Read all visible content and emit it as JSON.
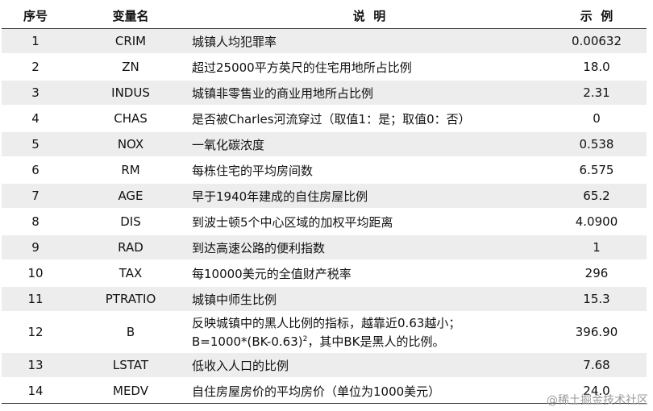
{
  "table": {
    "headers": {
      "index": "序号",
      "variable": "变量名",
      "description": "说  明",
      "example": "示  例"
    },
    "rows": [
      {
        "index": "1",
        "variable": "CRIM",
        "description": "城镇人均犯罪率",
        "example": "0.00632"
      },
      {
        "index": "2",
        "variable": "ZN",
        "description": "超过25000平方英尺的住宅用地所占比例",
        "example": "18.0"
      },
      {
        "index": "3",
        "variable": "INDUS",
        "description": "城镇非零售业的商业用地所占比例",
        "example": "2.31"
      },
      {
        "index": "4",
        "variable": "CHAS",
        "description": "是否被Charles河流穿过（取值1：是；取值0：否）",
        "example": "0"
      },
      {
        "index": "5",
        "variable": "NOX",
        "description": "一氧化碳浓度",
        "example": "0.538"
      },
      {
        "index": "6",
        "variable": "RM",
        "description": "每栋住宅的平均房间数",
        "example": "6.575"
      },
      {
        "index": "7",
        "variable": "AGE",
        "description": "早于1940年建成的自住房屋比例",
        "example": "65.2"
      },
      {
        "index": "8",
        "variable": "DIS",
        "description": "到波士顿5个中心区域的加权平均距离",
        "example": "4.0900"
      },
      {
        "index": "9",
        "variable": "RAD",
        "description": "到达高速公路的便利指数",
        "example": "1"
      },
      {
        "index": "10",
        "variable": "TAX",
        "description": "每10000美元的全值财产税率",
        "example": "296"
      },
      {
        "index": "11",
        "variable": "PTRATIO",
        "description": "城镇中师生比例",
        "example": "15.3"
      },
      {
        "index": "12",
        "variable": "B",
        "description_line1": "反映城镇中的黑人比例的指标，越靠近0.63越小；",
        "description_line2_pre": "B=1000*(BK-0.63)",
        "description_line2_sup": "2",
        "description_line2_post": "，其中BK是黑人的比例。",
        "example": "396.90"
      },
      {
        "index": "13",
        "variable": "LSTAT",
        "description": "低收入人口的比例",
        "example": "7.68"
      },
      {
        "index": "14",
        "variable": "MEDV",
        "description": "自住房屋房价的平均房价（单位为1000美元）",
        "example": "24.0"
      }
    ]
  },
  "watermark": "@稀土掘金技术社区"
}
